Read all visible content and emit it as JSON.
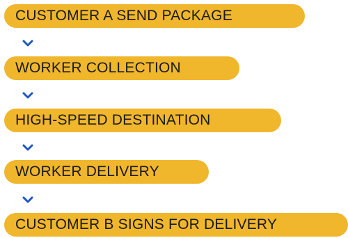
{
  "colors": {
    "step_fill": "#f0b62c",
    "arrow": "#1f57c3"
  },
  "arrow_icon": "chevron-down-icon",
  "steps": [
    {
      "label": "CUSTOMER A SEND PACKAGE"
    },
    {
      "label": "WORKER COLLECTION"
    },
    {
      "label": "HIGH-SPEED DESTINATION"
    },
    {
      "label": "WORKER DELIVERY"
    },
    {
      "label": "CUSTOMER B SIGNS FOR DELIVERY"
    }
  ]
}
